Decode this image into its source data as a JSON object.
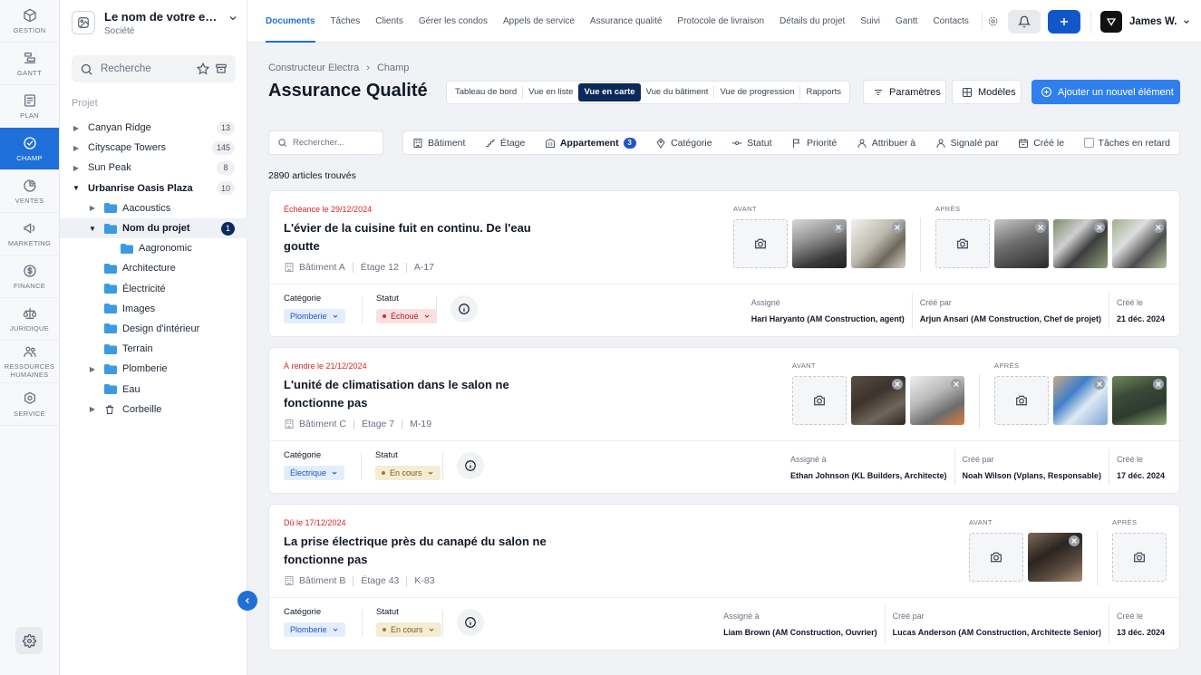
{
  "rail": [
    {
      "name": "rail-gestion",
      "icon": "cube-icon",
      "label": "GESTION",
      "active": false
    },
    {
      "name": "rail-gantt",
      "icon": "gantt-icon",
      "label": "GANTT",
      "active": false
    },
    {
      "name": "rail-plan",
      "icon": "plan-icon",
      "label": "PLAN",
      "active": false
    },
    {
      "name": "rail-champ",
      "icon": "check-circle-icon",
      "label": "CHAMP",
      "active": true
    },
    {
      "name": "rail-ventes",
      "icon": "pie-icon",
      "label": "VENTES",
      "active": false
    },
    {
      "name": "rail-marketing",
      "icon": "megaphone-icon",
      "label": "MARKETING",
      "active": false
    },
    {
      "name": "rail-finance",
      "icon": "dollar-icon",
      "label": "FINANCE",
      "active": false
    },
    {
      "name": "rail-juridique",
      "icon": "scale-icon",
      "label": "JURIDIQUE",
      "active": false
    },
    {
      "name": "rail-rh",
      "icon": "people-icon",
      "label": "RESSOURCES HUMAINES",
      "active": false
    },
    {
      "name": "rail-service",
      "icon": "service-icon",
      "label": "SERVICE",
      "active": false
    }
  ],
  "company": {
    "name": "Le nom de votre entreprise",
    "sub": "Société"
  },
  "tree": {
    "search_placeholder": "Recherche",
    "section": "Projet",
    "nodes": [
      {
        "label": "Canyan Ridge",
        "depth": 0,
        "arrow": "right",
        "folder": false,
        "count": "13"
      },
      {
        "label": "Cityscape Towers",
        "depth": 0,
        "arrow": "right",
        "folder": false,
        "count": "145"
      },
      {
        "label": "Sun Peak",
        "depth": 0,
        "arrow": "right",
        "folder": false,
        "count": "8"
      },
      {
        "label": "Urbanrise Oasis Plaza",
        "depth": 0,
        "arrow": "down",
        "folder": false,
        "count": "10",
        "bold": true
      },
      {
        "label": "Aacoustics",
        "depth": 1,
        "arrow": "right",
        "folder": true,
        "count": ""
      },
      {
        "label": "Nom du projet",
        "depth": 1,
        "arrow": "down",
        "folder": true,
        "count": "1",
        "bold": true,
        "selected": true
      },
      {
        "label": "Aagronomic",
        "depth": 2,
        "arrow": "",
        "folder": true,
        "count": ""
      },
      {
        "label": "Architecture",
        "depth": 1,
        "arrow": "",
        "folder": true,
        "count": ""
      },
      {
        "label": "Électricité",
        "depth": 1,
        "arrow": "",
        "folder": true,
        "count": ""
      },
      {
        "label": "Images",
        "depth": 1,
        "arrow": "",
        "folder": true,
        "count": ""
      },
      {
        "label": "Design d'intérieur",
        "depth": 1,
        "arrow": "",
        "folder": true,
        "count": ""
      },
      {
        "label": "Terrain",
        "depth": 1,
        "arrow": "",
        "folder": true,
        "count": ""
      },
      {
        "label": "Plomberie",
        "depth": 1,
        "arrow": "right",
        "folder": true,
        "count": ""
      },
      {
        "label": "Eau",
        "depth": 1,
        "arrow": "",
        "folder": true,
        "count": ""
      },
      {
        "label": "Corbeille",
        "depth": 1,
        "arrow": "right",
        "folder": false,
        "trash": true,
        "count": ""
      }
    ]
  },
  "topnav": {
    "tabs": [
      "Documents",
      "Tâches",
      "Clients",
      "Gérer les condos",
      "Appels de service",
      "Assurance qualité",
      "Protocole de livraison",
      "Détails du projet",
      "Suivi",
      "Gantt",
      "Contacts"
    ],
    "active_tab": 0,
    "user": "James W."
  },
  "page": {
    "breadcrumb": [
      "Constructeur Electra",
      "Champ"
    ],
    "title": "Assurance Qualité",
    "views": [
      "Tableau de bord",
      "Vue en liste",
      "Vue en carte",
      "Vue du bâtiment",
      "Vue de progression",
      "Rapports"
    ],
    "active_view": 2,
    "params_label": "Paramètres",
    "models_label": "Modèles",
    "add_label": "Ajouter un nouvel élément",
    "search_placeholder": "Rechercher...",
    "filters": [
      {
        "label": "Bâtiment",
        "icon": "building-icon"
      },
      {
        "label": "Étage",
        "icon": "stairs-icon"
      },
      {
        "label": "Appartement",
        "icon": "apartment-icon",
        "badge": "3",
        "bold": true
      },
      {
        "label": "Catégorie",
        "icon": "tag-icon"
      },
      {
        "label": "Statut",
        "icon": "status-icon"
      },
      {
        "label": "Priorité",
        "icon": "flag-icon"
      },
      {
        "label": "Attribuer à",
        "icon": "user-icon"
      },
      {
        "label": "Signalé par",
        "icon": "user-icon"
      },
      {
        "label": "Créé le",
        "icon": "calendar-icon"
      },
      {
        "label": "Tâches en retard",
        "icon": "checkbox"
      }
    ],
    "found": "2890 articles trouvés"
  },
  "labels": {
    "before": "AVANT",
    "after": "APRÈS",
    "category": "Catégorie",
    "status": "Statut"
  },
  "cards": [
    {
      "due": "Échéance le 29/12/2024",
      "title": "L'évier de la cuisine fuit en continu. De l'eau goutte",
      "building": "Bâtiment A",
      "floor": "Étage 12",
      "unit": "A-17",
      "category": "Plomberie",
      "status": "Échoué",
      "status_color": "red",
      "before_photos": 2,
      "after_photos": 3,
      "people": [
        {
          "label": "Assigné",
          "value": "Hari Haryanto (AM Construction, agent)"
        },
        {
          "label": "Créé par",
          "value": "Arjun Ansari (AM Construction, Chef de projet)"
        },
        {
          "label": "Créé le",
          "value": "21 déc. 2024"
        }
      ]
    },
    {
      "due": "À rendre le 21/12/2024",
      "title": "L'unité de climatisation dans le salon ne fonctionne pas",
      "building": "Bâtiment C",
      "floor": "Étage 7",
      "unit": "M-19",
      "category": "Électrique",
      "status": "En cours",
      "status_color": "yellow",
      "before_photos": 2,
      "after_photos": 2,
      "people": [
        {
          "label": "Assigné à",
          "value": "Ethan Johnson (KL Builders, Architecte)"
        },
        {
          "label": "Créé par",
          "value": "Noah Wilson (Vplans, Responsable)"
        },
        {
          "label": "Créé le",
          "value": "17 déc. 2024"
        }
      ]
    },
    {
      "due": "Dû le 17/12/2024",
      "title": "La prise électrique près du canapé du salon ne fonctionne pas",
      "building": "Bâtiment B",
      "floor": "Étage 43",
      "unit": "K-83",
      "category": "Plomberie",
      "status": "En cours",
      "status_color": "yellow",
      "before_photos": 1,
      "after_photos": 0,
      "people": [
        {
          "label": "Assigné à",
          "value": "Liam Brown (AM Construction, Ouvrier)"
        },
        {
          "label": "Créé par",
          "value": "Lucas Anderson (AM Construction, Architecte Senior)"
        },
        {
          "label": "Créé le",
          "value": "13 déc. 2024"
        }
      ]
    }
  ]
}
